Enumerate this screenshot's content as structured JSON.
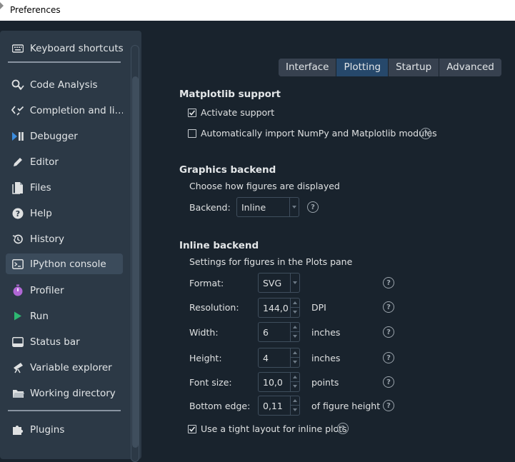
{
  "window": {
    "title": "Preferences"
  },
  "sidebar": {
    "items": [
      {
        "label": "Keyboard shortcuts",
        "icon": "keyboard-icon"
      },
      {
        "label": "Code Analysis",
        "icon": "code-analysis-icon"
      },
      {
        "label": "Completion and li…",
        "icon": "completion-icon"
      },
      {
        "label": "Debugger",
        "icon": "debugger-icon"
      },
      {
        "label": "Editor",
        "icon": "pencil-icon"
      },
      {
        "label": "Files",
        "icon": "files-icon"
      },
      {
        "label": "Help",
        "icon": "help-icon"
      },
      {
        "label": "History",
        "icon": "history-icon"
      },
      {
        "label": "IPython console",
        "icon": "console-icon",
        "selected": true
      },
      {
        "label": "Profiler",
        "icon": "profiler-icon"
      },
      {
        "label": "Run",
        "icon": "run-icon"
      },
      {
        "label": "Status bar",
        "icon": "status-bar-icon"
      },
      {
        "label": "Variable explorer",
        "icon": "telescope-icon"
      },
      {
        "label": "Working directory",
        "icon": "folder-icon"
      },
      {
        "label": "Plugins",
        "icon": "puzzle-icon"
      }
    ]
  },
  "tabs": [
    {
      "label": "Interface"
    },
    {
      "label": "Plotting",
      "active": true
    },
    {
      "label": "Startup"
    },
    {
      "label": "Advanced"
    }
  ],
  "matplotlib": {
    "title": "Matplotlib support",
    "activate_label": "Activate support",
    "activate_checked": true,
    "autoimport_label": "Automatically import NumPy and Matplotlib modules",
    "autoimport_checked": false
  },
  "graphics": {
    "title": "Graphics backend",
    "description": "Choose how figures are displayed",
    "backend_label": "Backend:",
    "backend_value": "Inline"
  },
  "inline": {
    "title": "Inline backend",
    "description": "Settings for figures in the Plots pane",
    "format_label": "Format:",
    "format_value": "SVG",
    "resolution_label": "Resolution:",
    "resolution_value": "144,0",
    "resolution_unit": "DPI",
    "width_label": "Width:",
    "width_value": "6",
    "width_unit": "inches",
    "height_label": "Height:",
    "height_value": "4",
    "height_unit": "inches",
    "fontsize_label": "Font size:",
    "fontsize_value": "10,0",
    "fontsize_unit": "points",
    "bottom_label": "Bottom edge:",
    "bottom_value": "0,11",
    "bottom_unit": "of figure height",
    "tight_label": "Use a tight layout for inline plots",
    "tight_checked": true
  },
  "help_glyph": "?",
  "colors": {
    "background": "#19232d",
    "sidebar": "#2c3946",
    "active_tab": "#26486b",
    "selected_item": "#3b4b5b"
  }
}
